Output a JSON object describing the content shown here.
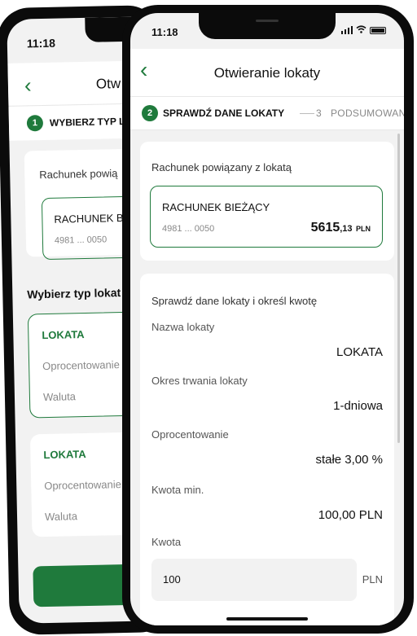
{
  "back_screen": {
    "time": "11:18",
    "title": "Otw",
    "step_number": "1",
    "step_label": "WYBIERZ TYP L",
    "account_section_label": "Rachunek powią",
    "account_name": "RACHUNEK BI",
    "account_number": "4981 ... 0050",
    "section_title": "Wybierz typ lokat",
    "deposit_cards": [
      {
        "title": "LOKATA",
        "rate_label": "Oprocentowanie",
        "currency_label": "Waluta"
      },
      {
        "title": "LOKATA",
        "rate_label": "Oprocentowanie",
        "currency_label": "Waluta"
      }
    ]
  },
  "front_screen": {
    "time": "11:18",
    "header": {
      "back_icon": "chevron-left-icon",
      "title": "Otwieranie lokaty"
    },
    "steps": {
      "current_number": "2",
      "current_label": "SPRAWDŹ DANE LOKATY",
      "next_number": "3",
      "next_label": "PODSUMOWANI"
    },
    "account_card": {
      "label": "Rachunek powiązany z lokatą",
      "account_name": "RACHUNEK BIEŻĄCY",
      "account_number": "4981 ... 0050",
      "balance_int": "5615",
      "balance_dec": ",13",
      "balance_currency": "PLN"
    },
    "details": {
      "title": "Sprawdź dane lokaty i określ kwotę",
      "fields": [
        {
          "label": "Nazwa lokaty",
          "value": "LOKATA"
        },
        {
          "label": "Okres trwania lokaty",
          "value": "1-dniowa"
        },
        {
          "label": "Oprocentowanie",
          "value": "stałe 3,00 %"
        },
        {
          "label": "Kwota min.",
          "value": "100,00 PLN"
        }
      ],
      "amount_label": "Kwota",
      "amount_value": "100",
      "amount_currency": "PLN"
    }
  },
  "colors": {
    "accent": "#1f7a3c",
    "background": "#f2f2f2",
    "card": "#ffffff"
  }
}
